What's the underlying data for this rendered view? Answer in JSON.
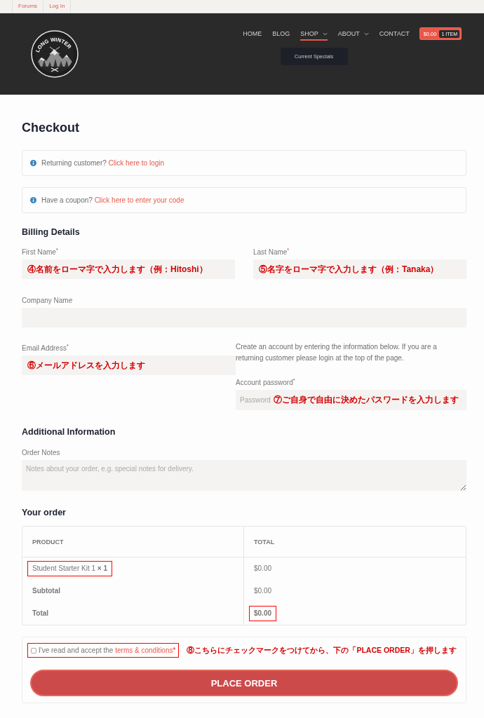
{
  "top_bar": {
    "links": [
      "Forums",
      "Log In"
    ]
  },
  "header": {
    "logo": {
      "text": "LONG WINTER"
    },
    "nav": [
      {
        "label": "HOME",
        "kind": "link",
        "selected": false
      },
      {
        "label": "BLOG",
        "kind": "link",
        "selected": false
      },
      {
        "label": "SHOP",
        "kind": "menu",
        "selected": true,
        "children": [
          {
            "label": "Current Specials"
          }
        ]
      },
      {
        "label": "ABOUT",
        "kind": "menu",
        "selected": false
      },
      {
        "label": "CONTACT",
        "kind": "link",
        "selected": false
      }
    ],
    "cart": {
      "amount": "$0.00",
      "count": "1 ITEM"
    }
  },
  "page_title": "Checkout",
  "notices": [
    {
      "text": "Returning customer?",
      "link": "Click here to login"
    },
    {
      "text": "Have a coupon?",
      "link": "Click here to enter your code"
    }
  ],
  "billing": {
    "title": "Billing Details",
    "name_fields": [
      {
        "label": "First Name$^{*}$",
        "note": "④名前をローマ字で入力します（例：Hitoshi）"
      },
      {
        "label": "Last Name$^{*}$",
        "note": "⑤名字をローマ字で入力します（例：Tanaka）"
      }
    ],
    "company": {
      "label": "Company Name"
    },
    "email": {
      "label": "Email Address$^{*}$",
      "note": "⑥メールアドレスを入力します"
    },
    "account": {
      "text": "Create an account by entering the information below. If you are a returning customer please login at the top of the page.",
      "password": {
        "label": "Account password$^{*}$",
        "placeholder": "Password",
        "note": "⑦ご自身で自由に決めたパスワードを入力します"
      }
    }
  },
  "additional": {
    "title": "Additional Information",
    "order_notes": {
      "label": "Order Notes",
      "placeholder": "Notes about your order, e.g. special notes for delivery."
    }
  },
  "order": {
    "title": "Your order",
    "columns": [
      "PRODUCT",
      "TOTAL"
    ],
    "rows": [
      {
        "kind": "item",
        "label": "Student Starter Kit 1 **× 1**",
        "value": "$0.00",
        "label_highlighted": true,
        "value_highlighted": false
      },
      {
        "kind": "subtotal",
        "label": "Subtotal",
        "value": "$0.00",
        "label_highlighted": false,
        "value_highlighted": false
      },
      {
        "kind": "total",
        "label": "Total",
        "value": "$0.00",
        "label_highlighted": false,
        "value_highlighted": true
      }
    ]
  },
  "payment": {
    "terms": {
      "checked": false,
      "highlighted": true,
      "text": "I've read and accept the",
      "link": "terms & conditions",
      "required_mark": "*"
    },
    "note": "⑧こちらにチェックマークをつけてから、下の「PLACE ORDER」を押します",
    "button": "PLACE ORDER"
  }
}
